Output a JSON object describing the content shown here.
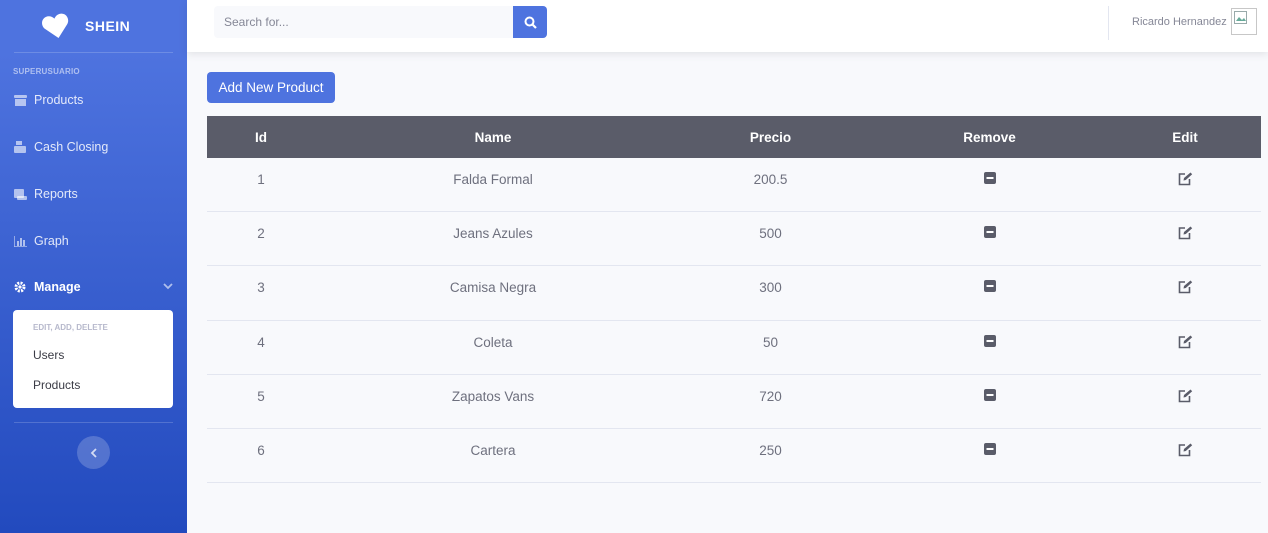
{
  "brand": {
    "name": "SHEIN"
  },
  "sidebar": {
    "heading": "SUPERUSUARIO",
    "items": [
      {
        "label": "Products",
        "icon": "store-icon"
      },
      {
        "label": "Cash Closing",
        "icon": "cash-register-icon"
      },
      {
        "label": "Reports",
        "icon": "scroll-icon"
      },
      {
        "label": "Graph",
        "icon": "chart-area-icon"
      },
      {
        "label": "Manage",
        "icon": "cog-icon"
      }
    ],
    "manage_menu": {
      "header": "EDIT, ADD, DELETE",
      "items": [
        "Users",
        "Products"
      ]
    }
  },
  "topbar": {
    "search_placeholder": "Search for...",
    "user_name": "Ricardo Hernandez"
  },
  "main": {
    "add_button": "Add New Product",
    "columns": [
      "Id",
      "Name",
      "Precio",
      "Remove",
      "Edit"
    ],
    "rows": [
      {
        "id": "1",
        "name": "Falda Formal",
        "price": "200.5"
      },
      {
        "id": "2",
        "name": "Jeans Azules",
        "price": "500"
      },
      {
        "id": "3",
        "name": "Camisa Negra",
        "price": "300"
      },
      {
        "id": "4",
        "name": "Coleta",
        "price": "50"
      },
      {
        "id": "5",
        "name": "Zapatos Vans",
        "price": "720"
      },
      {
        "id": "6",
        "name": "Cartera",
        "price": "250"
      }
    ]
  },
  "colors": {
    "primary": "#4e73df",
    "table_header": "#5a5c69",
    "text": "#6e707e"
  }
}
